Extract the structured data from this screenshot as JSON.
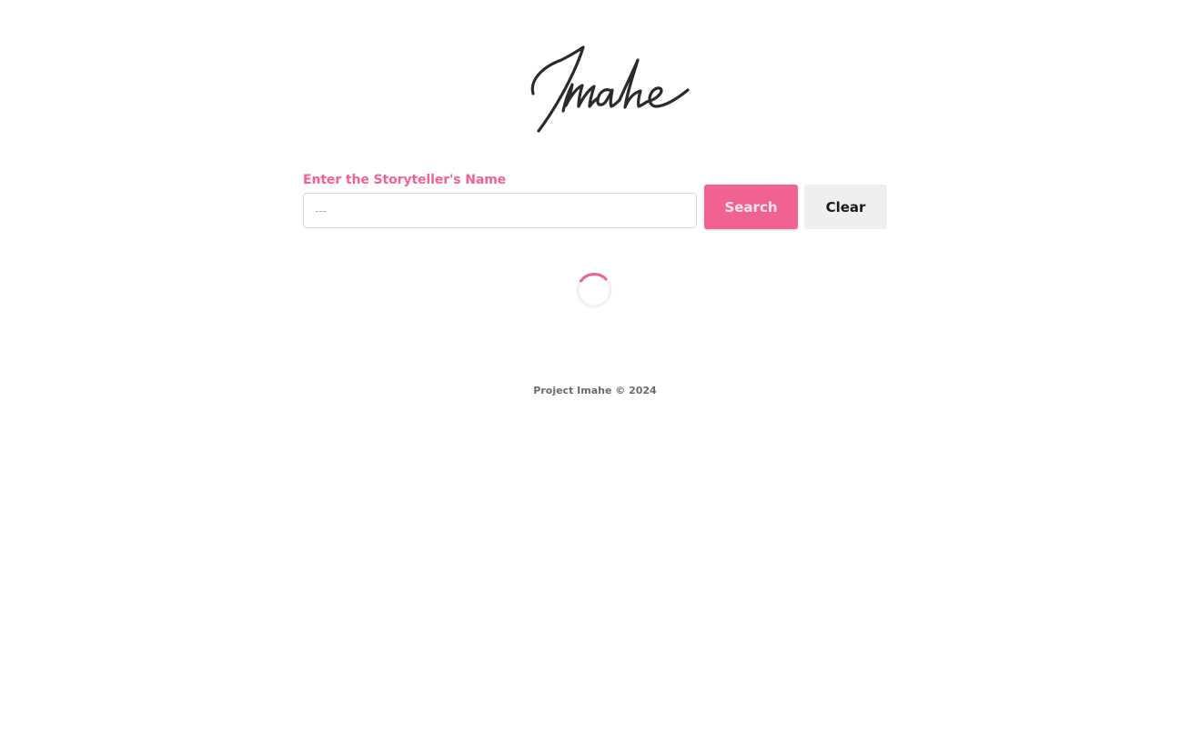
{
  "brand": {
    "logo_text": "Imahe"
  },
  "search": {
    "label": "Enter the Storyteller's Name",
    "value": "",
    "placeholder": "---",
    "search_button_label": "Search",
    "clear_button_label": "Clear"
  },
  "status": {
    "loading": true
  },
  "footer": {
    "text": "Project Imahe © 2024"
  },
  "colors": {
    "accent": "#f06292",
    "clear_button_bg": "#efefef",
    "spinner_track": "#f1f1f1"
  }
}
